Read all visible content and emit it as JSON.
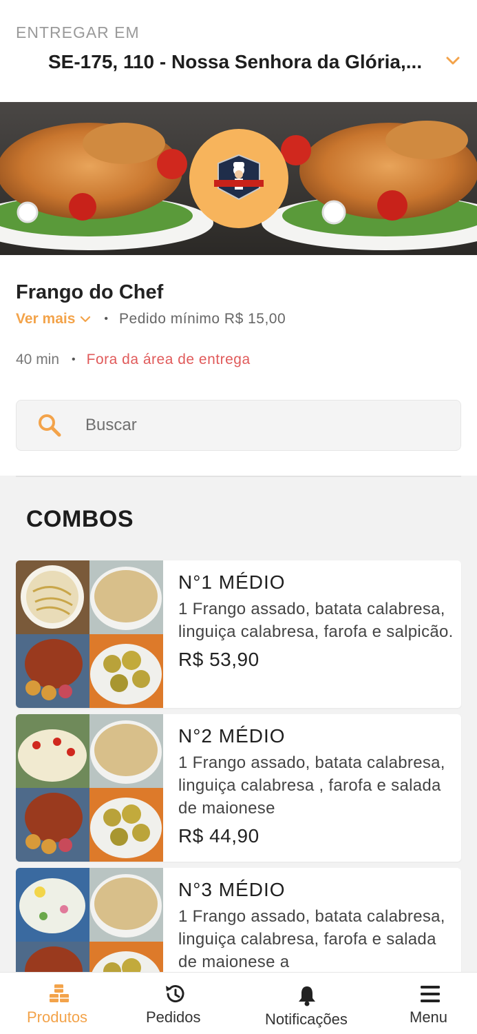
{
  "header": {
    "deliver_label": "ENTREGAR EM",
    "address": "SE-175, 110 - Nossa Senhora da Glória,..."
  },
  "store": {
    "name": "Frango do Chef",
    "logo_text": "Frango do Chef",
    "see_more": "Ver mais",
    "separator": "•",
    "min_order": "Pedido mínimo R$ 15,00",
    "delivery_time": "40 min",
    "status": "Fora da área de entrega"
  },
  "search": {
    "placeholder": "Buscar"
  },
  "section": {
    "title": "COMBOS"
  },
  "products": [
    {
      "title": "N°1 MÉDIO",
      "description": "1 Frango assado, batata calabresa, linguiça calabresa, farofa e salpicão.",
      "price": "R$ 53,90"
    },
    {
      "title": "N°2 MÉDIO",
      "description": "1 Frango assado, batata calabresa, linguiça calabresa , farofa e salada de maionese",
      "price": "R$ 44,90"
    },
    {
      "title": "N°3 MÉDIO",
      "description": "1 Frango assado, batata calabresa, linguiça calabresa, farofa e salada de maionese a",
      "price": ""
    }
  ],
  "bottom_nav": [
    {
      "label": "Produtos",
      "icon": "cubes-icon",
      "active": true
    },
    {
      "label": "Pedidos",
      "icon": "history-icon",
      "active": false
    },
    {
      "label": "Notificações",
      "icon": "bell-icon",
      "active": false
    },
    {
      "label": "Menu",
      "icon": "menu-icon",
      "active": false
    }
  ],
  "colors": {
    "accent": "#f3a34a",
    "logo_bg": "#f7b45c",
    "error": "#e05a5a",
    "section_bg": "#f2f2f2"
  }
}
